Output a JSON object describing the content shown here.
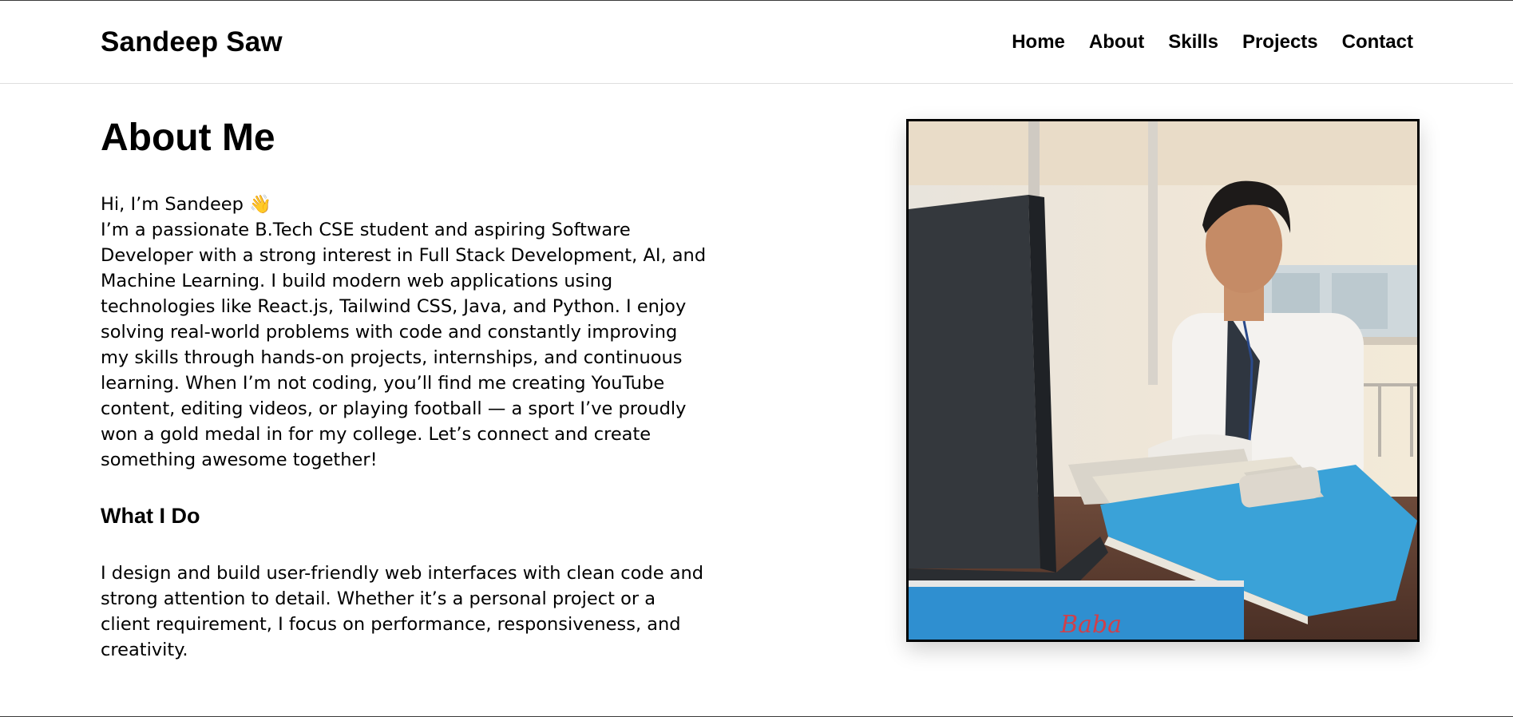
{
  "header": {
    "brand": "Sandeep Saw",
    "nav": [
      "Home",
      "About",
      "Skills",
      "Projects",
      "Contact"
    ]
  },
  "about": {
    "title": "About Me",
    "greeting": "Hi, I’m Sandeep 👋",
    "paragraph": "I’m a passionate B.Tech CSE student and aspiring Software Developer with a strong interest in Full Stack Development, AI, and Machine Learning. I build modern web applications using technologies like React.js, Tailwind CSS, Java, and Python. I enjoy solving real-world problems with code and constantly improving my skills through hands-on projects, internships, and continuous learning. When I’m not coding, you’ll find me creating YouTube content, editing videos, or playing football — a sport I’ve proudly won a gold medal in for my college. Let’s connect and create something awesome together!",
    "what_title": "What I Do",
    "what_text": "I design and build user-friendly web interfaces with clean code and strong attention to detail. Whether it’s a personal project or a client requirement, I focus on performance, responsiveness, and creativity."
  }
}
